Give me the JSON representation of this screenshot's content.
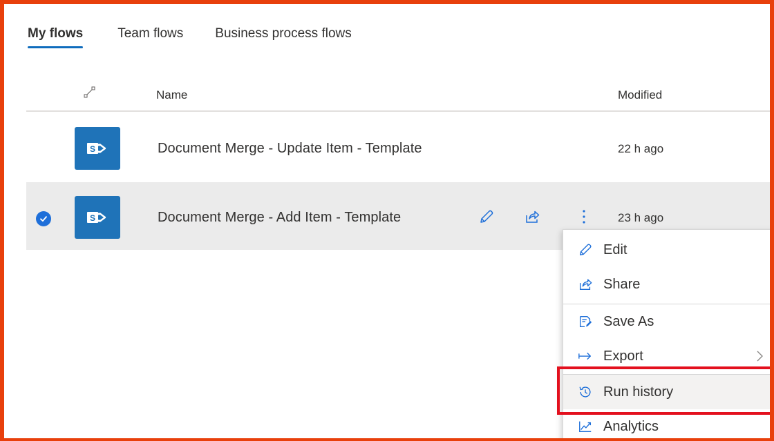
{
  "tabs": [
    {
      "label": "My flows",
      "active": true
    },
    {
      "label": "Team flows",
      "active": false
    },
    {
      "label": "Business process flows",
      "active": false
    }
  ],
  "table": {
    "headers": {
      "name": "Name",
      "modified": "Modified"
    },
    "rows": [
      {
        "name": "Document Merge - Update Item - Template",
        "modified": "22 h ago",
        "selected": false,
        "icon": "sharepoint-icon"
      },
      {
        "name": "Document Merge - Add Item - Template",
        "modified": "23 h ago",
        "selected": true,
        "icon": "sharepoint-icon"
      }
    ]
  },
  "context_menu": {
    "items": [
      {
        "label": "Edit",
        "icon": "pencil-icon"
      },
      {
        "label": "Share",
        "icon": "share-icon"
      },
      {
        "label": "Save As",
        "icon": "save-as-icon"
      },
      {
        "label": "Export",
        "icon": "export-arrow-icon",
        "has_submenu": true
      },
      {
        "label": "Run history",
        "icon": "history-clock-icon",
        "highlighted": true
      },
      {
        "label": "Analytics",
        "icon": "analytics-chart-icon"
      }
    ]
  },
  "colors": {
    "accent": "#0f6cbd",
    "outer_border": "#e8400c",
    "highlight_border": "#e3101e",
    "sharepoint_tile": "#1f73b8",
    "selected_row": "#ebebeb"
  }
}
